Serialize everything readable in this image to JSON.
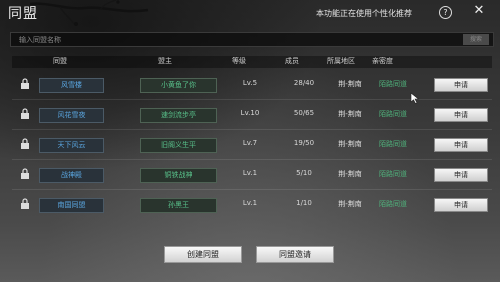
{
  "window": {
    "title": "同盟"
  },
  "top": {
    "notice": "本功能正在使用个性化推荐",
    "help_glyph": "?",
    "close_glyph": "✕"
  },
  "search": {
    "placeholder": "输入同盟名称",
    "button": "搜索"
  },
  "table": {
    "headers": [
      "同盟",
      "盟主",
      "等级",
      "成员",
      "所属地区",
      "亲密度"
    ],
    "rows": [
      {
        "name": "风雪楼",
        "leader": "小黄鱼了你",
        "level": "Lv.5",
        "members": "28/40",
        "region": "荆-荆南",
        "relation": "陌路同道",
        "action": "申请"
      },
      {
        "name": "风花雪夜",
        "leader": "速剑流步亭",
        "level": "Lv.10",
        "members": "50/65",
        "region": "荆-荆南",
        "relation": "陌路同道",
        "action": "申请"
      },
      {
        "name": "天下风云",
        "leader": "旧阁义生平",
        "level": "Lv.7",
        "members": "19/50",
        "region": "荆-荆南",
        "relation": "陌路同道",
        "action": "申请"
      },
      {
        "name": "战神殿",
        "leader": "铜铁战神",
        "level": "Lv.1",
        "members": "5/10",
        "region": "荆-荆南",
        "relation": "陌路同道",
        "action": "申请"
      },
      {
        "name": "南国同盟",
        "leader": "孙黑王",
        "level": "Lv.1",
        "members": "1/10",
        "region": "荆-荆南",
        "relation": "陌路同道",
        "action": "申请"
      }
    ]
  },
  "buttons": {
    "create": "创建同盟",
    "invite": "同盟邀请"
  },
  "colors": {
    "accent_blue": "#5aa6e0",
    "accent_green": "#58c08a"
  }
}
